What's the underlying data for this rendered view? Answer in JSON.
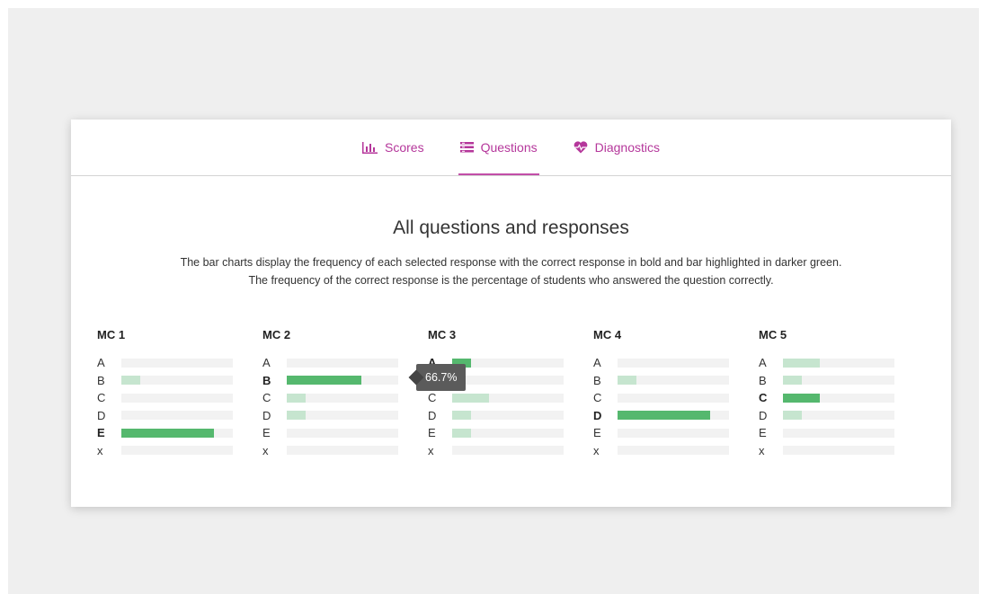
{
  "tabs": [
    {
      "label": "Scores",
      "icon": "bar-chart-icon",
      "active": false
    },
    {
      "label": "Questions",
      "icon": "list-icon",
      "active": true
    },
    {
      "label": "Diagnostics",
      "icon": "heart-pulse-icon",
      "active": false
    }
  ],
  "title": "All questions and responses",
  "description": [
    "The bar charts display the frequency of each selected response with the correct response in bold and bar highlighted in darker green.",
    "The frequency of the correct response is the percentage of students who answered the question correctly."
  ],
  "colors": {
    "accent": "#b5379b",
    "correct": "#55b86e",
    "incorrect": "#c6e5cf",
    "track": "#f2f2f2",
    "tooltip": "#5b5b5b"
  },
  "tooltip": {
    "text": "66.7%"
  },
  "chart_data": {
    "type": "bar",
    "xlim": [
      0,
      100
    ],
    "questions": [
      {
        "name": "MC 1",
        "correct": "E",
        "responses": [
          {
            "label": "A",
            "value": 0
          },
          {
            "label": "B",
            "value": 16.7
          },
          {
            "label": "C",
            "value": 0
          },
          {
            "label": "D",
            "value": 0
          },
          {
            "label": "E",
            "value": 83.3
          },
          {
            "label": "x",
            "value": 0
          }
        ]
      },
      {
        "name": "MC 2",
        "correct": "B",
        "responses": [
          {
            "label": "A",
            "value": 0
          },
          {
            "label": "B",
            "value": 66.7
          },
          {
            "label": "C",
            "value": 16.7
          },
          {
            "label": "D",
            "value": 16.7
          },
          {
            "label": "E",
            "value": 0
          },
          {
            "label": "x",
            "value": 0
          }
        ]
      },
      {
        "name": "MC 3",
        "correct": "A",
        "responses": [
          {
            "label": "A",
            "value": 16.7
          },
          {
            "label": "B",
            "value": 0
          },
          {
            "label": "C",
            "value": 33.3
          },
          {
            "label": "D",
            "value": 16.7
          },
          {
            "label": "E",
            "value": 16.7
          },
          {
            "label": "x",
            "value": 0
          }
        ]
      },
      {
        "name": "MC 4",
        "correct": "D",
        "responses": [
          {
            "label": "A",
            "value": 0
          },
          {
            "label": "B",
            "value": 16.7
          },
          {
            "label": "C",
            "value": 0
          },
          {
            "label": "D",
            "value": 83.3
          },
          {
            "label": "E",
            "value": 0
          },
          {
            "label": "x",
            "value": 0
          }
        ]
      },
      {
        "name": "MC 5",
        "correct": "C",
        "responses": [
          {
            "label": "A",
            "value": 33.3
          },
          {
            "label": "B",
            "value": 16.7
          },
          {
            "label": "C",
            "value": 33.3
          },
          {
            "label": "D",
            "value": 16.7
          },
          {
            "label": "E",
            "value": 0
          },
          {
            "label": "x",
            "value": 0
          }
        ]
      }
    ]
  }
}
